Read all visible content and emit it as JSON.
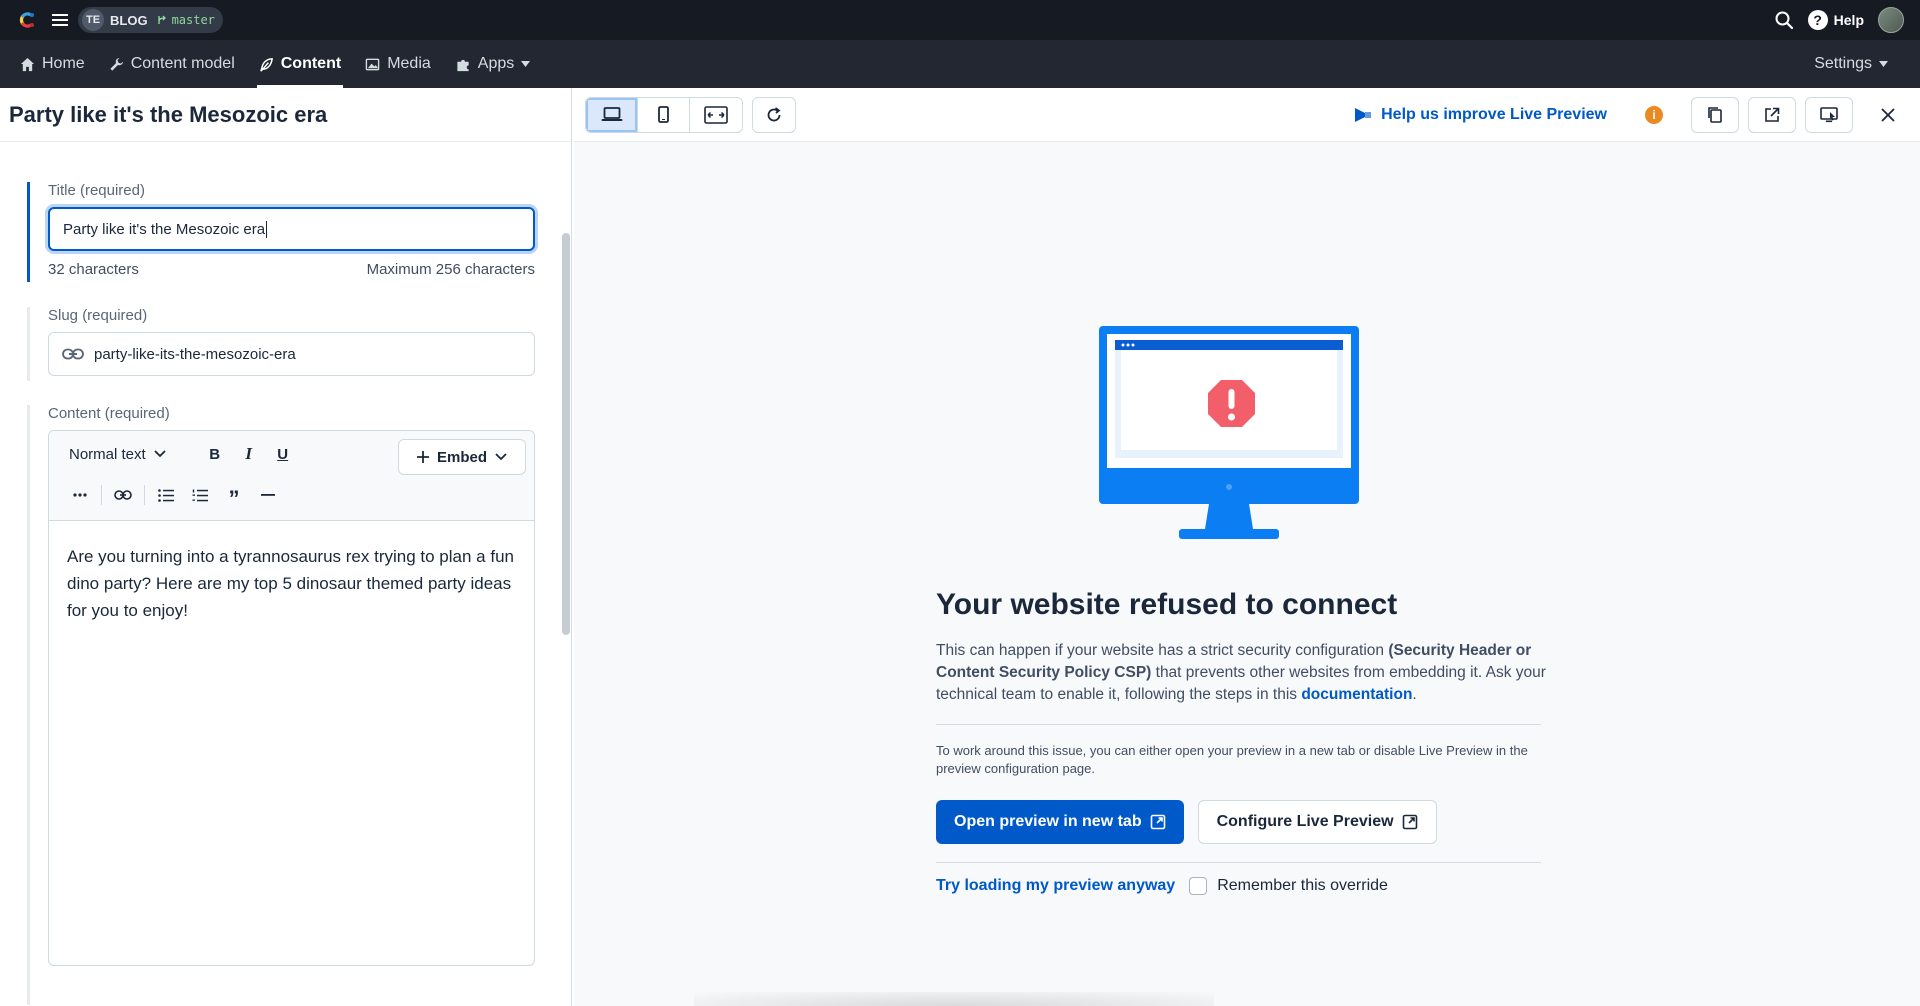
{
  "topbar": {
    "space_initials": "TE",
    "space_name": "BLOG",
    "environment": "master",
    "help_label": "Help"
  },
  "nav": {
    "items": [
      {
        "label": "Home",
        "icon": "home-icon"
      },
      {
        "label": "Content model",
        "icon": "wrench-icon"
      },
      {
        "label": "Content",
        "icon": "feather-icon",
        "active": true
      },
      {
        "label": "Media",
        "icon": "image-icon"
      },
      {
        "label": "Apps",
        "icon": "puzzle-icon"
      }
    ],
    "settings_label": "Settings"
  },
  "entry": {
    "title": "Party like it's the Mesozoic era",
    "fields": {
      "title": {
        "label": "Title (required)",
        "value": "Party like it's the Mesozoic era",
        "count": "32 characters",
        "max": "Maximum 256 characters"
      },
      "slug": {
        "label": "Slug (required)",
        "value": "party-like-its-the-mesozoic-era"
      },
      "content": {
        "label": "Content (required)",
        "format_select": "Normal text",
        "embed_label": "Embed",
        "body": "Are you turning into a tyrannosaurus rex trying to plan a fun dino party? Here are my top 5 dinosaur themed party ideas for you to enjoy!"
      }
    }
  },
  "preview": {
    "improve_link": "Help us improve Live Preview",
    "error": {
      "title": "Your website refused to connect",
      "desc_1": "This can happen if your website has a strict security configuration ",
      "desc_bold": "(Security Header or Content Security Policy CSP)",
      "desc_2": " that prevents other websites from embedding it. Ask your technical team to enable it, following the steps in this ",
      "desc_link": "documentation",
      "desc_end": ".",
      "note": "To work around this issue, you can either open your preview in a new tab or disable Live Preview in the preview configuration page.",
      "primary_button": "Open preview in new tab",
      "secondary_button": "Configure Live Preview",
      "try_link": "Try loading my preview anyway",
      "remember_label": "Remember this override"
    }
  },
  "colors": {
    "accent": "#0059c8",
    "topbar": "#161a22",
    "navbar": "#222731",
    "warning": "#ea8a22",
    "error_red": "#f25f6b",
    "monitor_blue": "#0a7ef2"
  }
}
